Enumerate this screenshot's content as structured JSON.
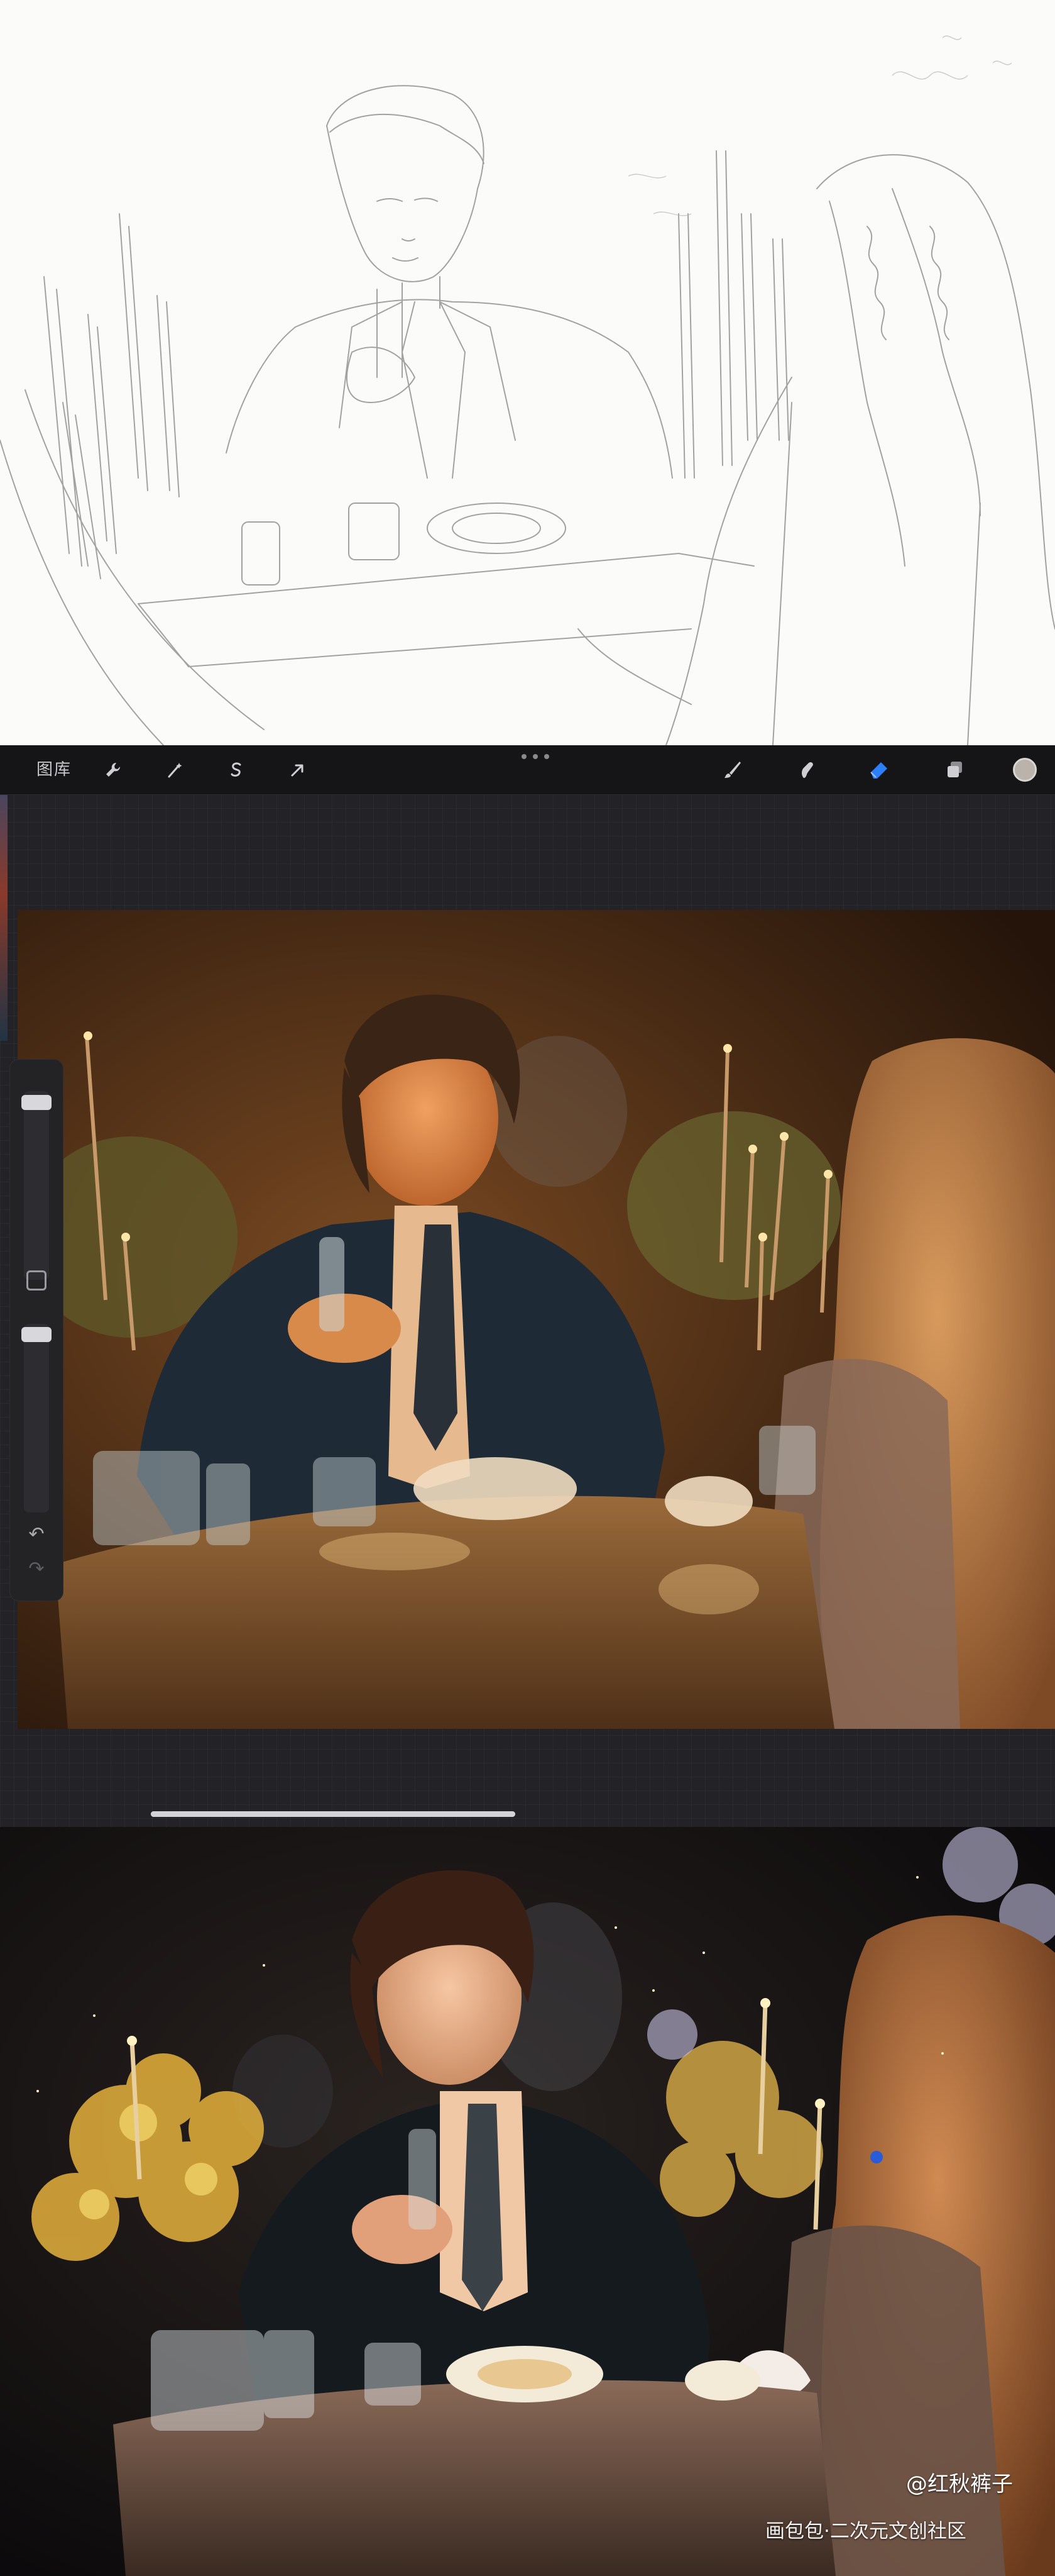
{
  "toolbar": {
    "gallery_label": "图库",
    "tools_left": [
      "wrench-icon",
      "magic-wand-icon",
      "selection-icon",
      "transform-arrow-icon"
    ],
    "tools_right": [
      "brush-icon",
      "smudge-icon",
      "eraser-icon",
      "layers-icon",
      "color-icon"
    ],
    "active_tool": "eraser-icon",
    "color": "#b9b3ac",
    "accent": "#2d7ff9"
  },
  "sidebar": {
    "brush_size_level": 0.05,
    "opacity_level": 0.05
  },
  "watermark": {
    "user": "@红秋裤子",
    "site": "画包包·二次元文创社区"
  }
}
